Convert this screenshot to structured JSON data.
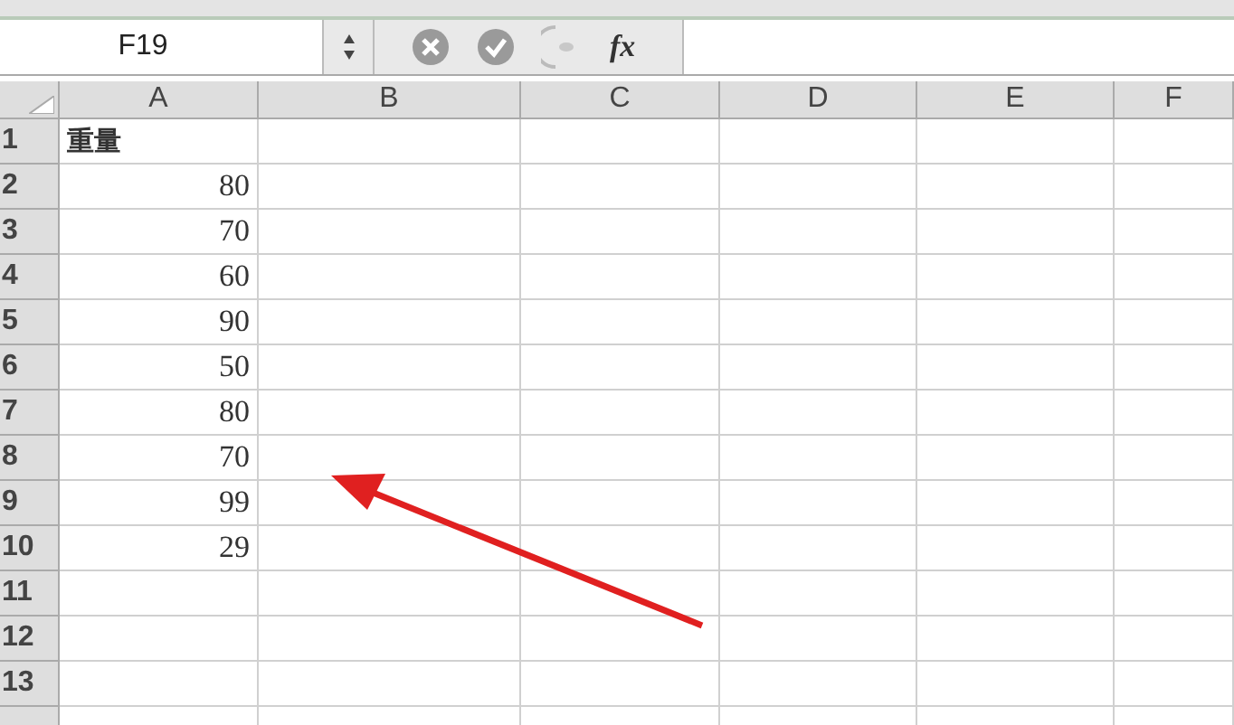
{
  "formula_bar": {
    "name_box": "F19",
    "function_button": "fx"
  },
  "columns": [
    "A",
    "B",
    "C",
    "D",
    "E",
    "F"
  ],
  "rows": [
    {
      "label": "1",
      "cells": [
        {
          "text": "重量",
          "kind": "text"
        }
      ]
    },
    {
      "label": "2",
      "cells": [
        {
          "text": "80",
          "kind": "number"
        }
      ]
    },
    {
      "label": "3",
      "cells": [
        {
          "text": "70",
          "kind": "number"
        }
      ]
    },
    {
      "label": "4",
      "cells": [
        {
          "text": "60",
          "kind": "number"
        }
      ]
    },
    {
      "label": "5",
      "cells": [
        {
          "text": "90",
          "kind": "number"
        }
      ]
    },
    {
      "label": "6",
      "cells": [
        {
          "text": "50",
          "kind": "number"
        }
      ]
    },
    {
      "label": "7",
      "cells": [
        {
          "text": "80",
          "kind": "number"
        }
      ]
    },
    {
      "label": "8",
      "cells": [
        {
          "text": "70",
          "kind": "number"
        }
      ]
    },
    {
      "label": "9",
      "cells": [
        {
          "text": "99",
          "kind": "number"
        }
      ]
    },
    {
      "label": "10",
      "cells": [
        {
          "text": "29",
          "kind": "number"
        }
      ]
    },
    {
      "label": "11"
    },
    {
      "label": "12"
    },
    {
      "label": "13"
    }
  ],
  "annotation": {
    "kind": "arrow"
  }
}
